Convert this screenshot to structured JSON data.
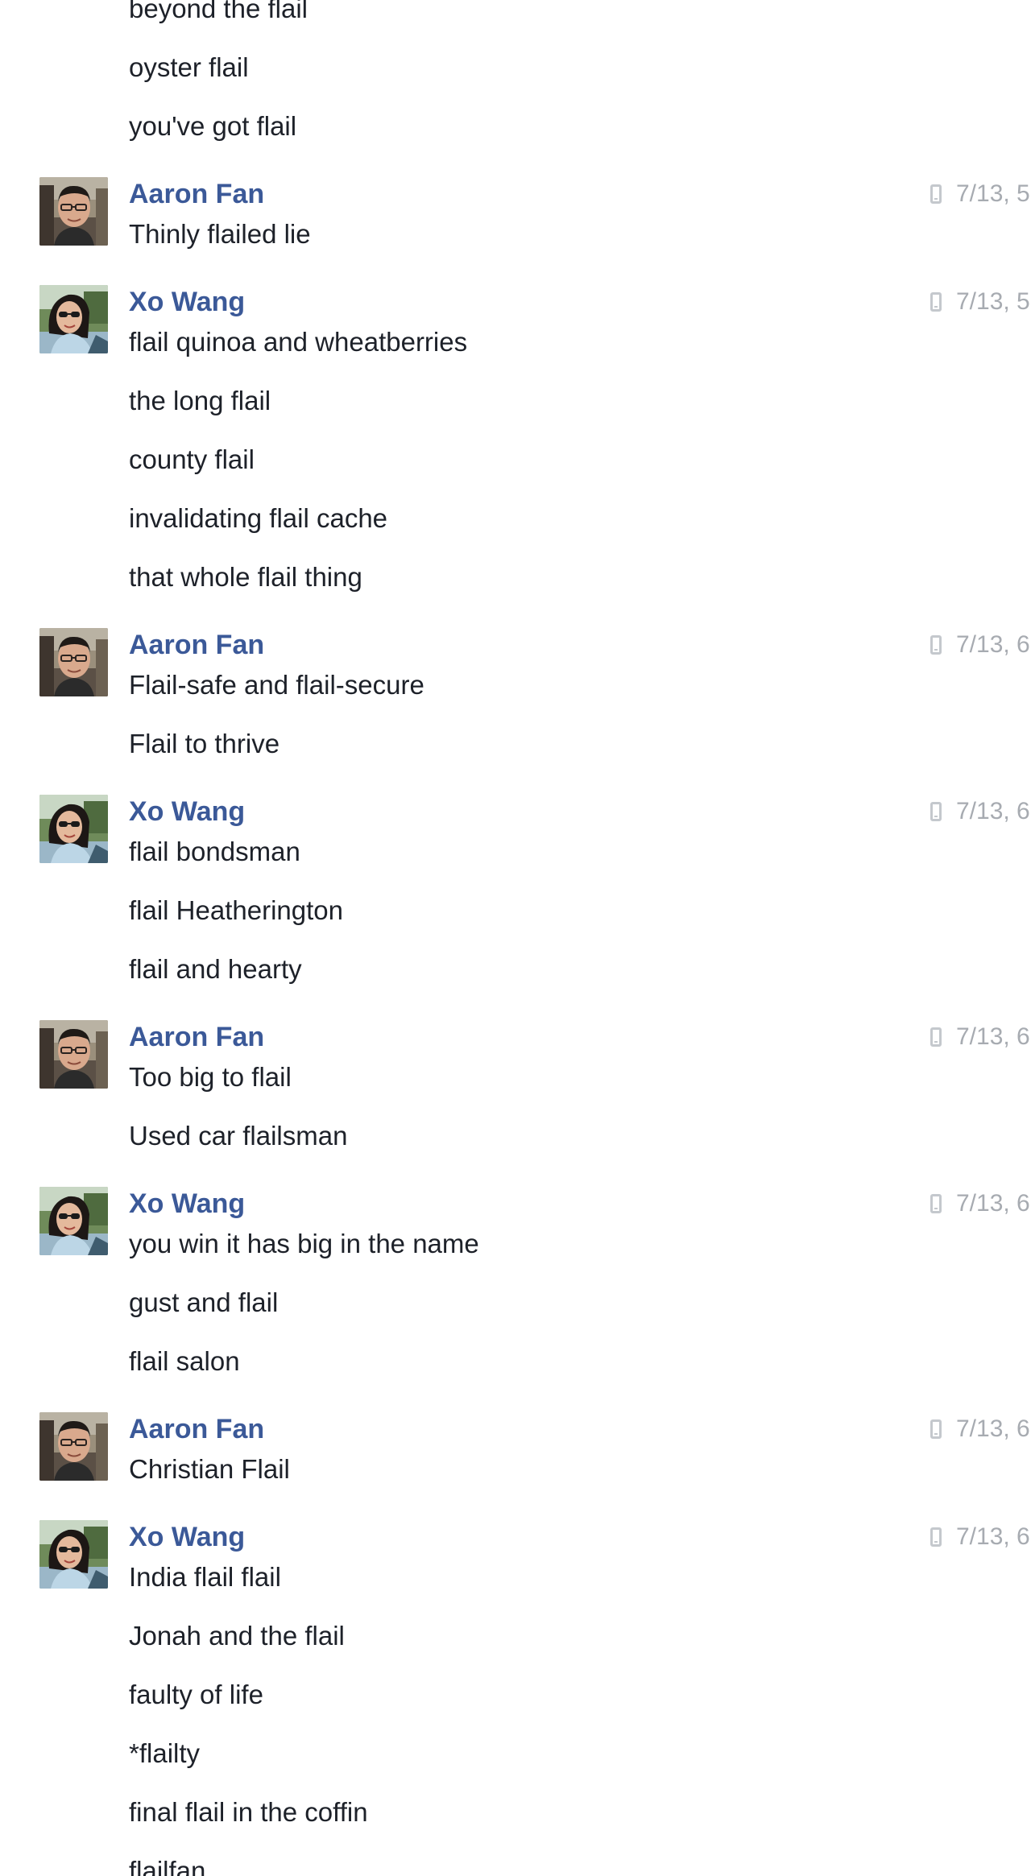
{
  "thread": {
    "groups": [
      {
        "sender": null,
        "avatar": null,
        "timestamp": null,
        "messages": [
          "beyond the flail",
          "oyster flail",
          "you've got flail"
        ]
      },
      {
        "sender": "Aaron Fan",
        "avatar": "aaron",
        "timestamp": "7/13, 5",
        "messages": [
          "Thinly flailed lie"
        ]
      },
      {
        "sender": "Xo Wang",
        "avatar": "xo",
        "timestamp": "7/13, 5",
        "messages": [
          "flail quinoa and wheatberries",
          "the long flail",
          "county flail",
          "invalidating flail cache",
          "that whole flail thing"
        ]
      },
      {
        "sender": "Aaron Fan",
        "avatar": "aaron",
        "timestamp": "7/13, 6",
        "messages": [
          "Flail-safe and flail-secure",
          "Flail to thrive"
        ]
      },
      {
        "sender": "Xo Wang",
        "avatar": "xo",
        "timestamp": "7/13, 6",
        "messages": [
          "flail bondsman",
          "flail Heatherington",
          "flail and hearty"
        ]
      },
      {
        "sender": "Aaron Fan",
        "avatar": "aaron",
        "timestamp": "7/13, 6",
        "messages": [
          "Too big to flail",
          "Used car flailsman"
        ]
      },
      {
        "sender": "Xo Wang",
        "avatar": "xo",
        "timestamp": "7/13, 6",
        "messages": [
          "you win it has big in the name",
          "gust and flail",
          "flail salon"
        ]
      },
      {
        "sender": "Aaron Fan",
        "avatar": "aaron",
        "timestamp": "7/13, 6",
        "messages": [
          "Christian Flail"
        ]
      },
      {
        "sender": "Xo Wang",
        "avatar": "xo",
        "timestamp": "7/13, 6",
        "messages": [
          "India flail flail",
          "Jonah and the flail",
          "faulty of life",
          "*flailty",
          "final flail in the coffin",
          "flailfan"
        ]
      }
    ]
  },
  "icons": {
    "timestamp_icon": "mobile-phone-icon"
  },
  "colors": {
    "sender_name": "#3b5998",
    "message_text": "#1d2129",
    "timestamp_text": "#a7abb1",
    "background": "#ffffff"
  }
}
